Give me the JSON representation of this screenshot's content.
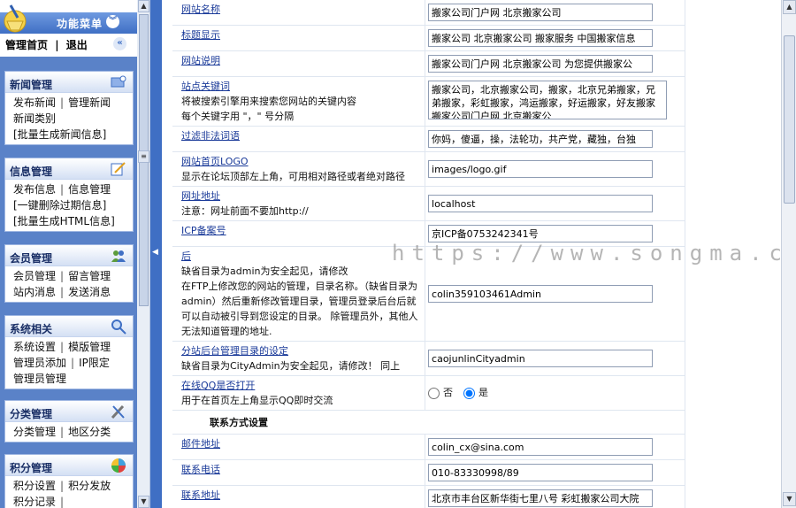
{
  "sidebar": {
    "title": "功能菜单",
    "home": "管理首页",
    "logout": "退出",
    "groups": [
      {
        "title": "新闻管理",
        "icon": "news-icon",
        "rows": [
          [
            "发布新闻",
            "管理新闻"
          ],
          [
            "新闻类别"
          ],
          [
            "[批量生成新闻信息]"
          ]
        ]
      },
      {
        "title": "信息管理",
        "icon": "edit-icon",
        "rows": [
          [
            "发布信息",
            "信息管理"
          ],
          [
            "[一键删除过期信息]"
          ],
          [
            "[批量生成HTML信息]"
          ]
        ]
      },
      {
        "title": "会员管理",
        "icon": "users-icon",
        "rows": [
          [
            "会员管理",
            "留言管理"
          ],
          [
            "站内消息",
            "发送消息"
          ]
        ]
      },
      {
        "title": "系统相关",
        "icon": "search-icon",
        "rows": [
          [
            "系统设置",
            "模版管理"
          ],
          [
            "管理员添加",
            "IP限定"
          ],
          [
            "管理员管理"
          ]
        ]
      },
      {
        "title": "分类管理",
        "icon": "tools-icon",
        "rows": [
          [
            "分类管理",
            "地区分类"
          ]
        ]
      },
      {
        "title": "积分管理",
        "icon": "color-wheel-icon",
        "rows": [
          [
            "积分设置",
            "积分发放"
          ],
          [
            "积分记录",
            ""
          ]
        ]
      }
    ]
  },
  "form": {
    "rows": [
      {
        "id": "site-name",
        "title": "网站名称",
        "desc": "",
        "value": "搬家公司门户网 北京搬家公司",
        "kind": "text"
      },
      {
        "id": "title-display",
        "title": "标题显示",
        "desc": "",
        "value": "搬家公司 北京搬家公司 搬家服务 中国搬家信息",
        "kind": "text"
      },
      {
        "id": "site-description",
        "title": "网站说明",
        "desc": "",
        "value": "搬家公司门户网 北京搬家公司 为您提供搬家公",
        "kind": "text"
      },
      {
        "id": "site-keywords",
        "title": "站点关键词",
        "desc": "将被搜索引擎用来搜索您网站的关键内容\n每个关键字用 \"，\" 号分隔",
        "value": "搬家公司，北京搬家公司，搬家，北京兄弟搬家，兄弟搬家，彩虹搬家，鸿运搬家，好运搬家，好友搬家 搬家公司门户网 北京搬家公",
        "kind": "textarea"
      },
      {
        "id": "filter-words",
        "title": "过滤非法词语",
        "desc": "",
        "value": "你妈，傻逼，操，法轮功，共产党，藏独，台独",
        "kind": "text"
      },
      {
        "id": "home-logo",
        "title": "网站首页LOGO",
        "desc": "显示在论坛顶部左上角，可用相对路径或者绝对路径",
        "value": "images/logo.gif",
        "kind": "text"
      },
      {
        "id": "site-url",
        "title": "网址地址",
        "desc": "注意：网址前面不要加http://",
        "value": "localhost",
        "kind": "text"
      },
      {
        "id": "icp",
        "title": "ICP备案号",
        "desc": "",
        "value": "京ICP备0753242341号",
        "kind": "text"
      },
      {
        "id": "admin-dir",
        "title": "后",
        "desc": "缺省目录为admin为安全起见，请修改\n在FTP上修改您的网站的管理，目录名称。（缺省目录为admin）然后重新修改管理目录，管理员登录后台后就可以自动被引导到您设定的目录。 除管理员外，其他人无法知道管理的地址.",
        "value": "colin359103461Admin",
        "kind": "text"
      },
      {
        "id": "branch-admin-dir",
        "title": "分站后台管理目录的设定",
        "desc": "缺省目录为CityAdmin为安全起见，请修改！ 同上",
        "value": "caojunlinCityadmin",
        "kind": "text"
      },
      {
        "id": "online-qq",
        "title": "在线QQ是否打开",
        "desc": "用于在首页左上角显示QQ即时交流",
        "kind": "radio",
        "options": [
          "否",
          "是"
        ],
        "selected": "是"
      },
      {
        "id": "contact-section",
        "kind": "section",
        "title": "联系方式设置"
      },
      {
        "id": "email",
        "title": "邮件地址",
        "desc": "",
        "value": "colin_cx@sina.com",
        "kind": "text"
      },
      {
        "id": "phone",
        "title": "联系电话",
        "desc": "",
        "value": "010-83330998/89",
        "kind": "text"
      },
      {
        "id": "address",
        "title": "联系地址",
        "desc": "",
        "value": "北京市丰台区新华街七里八号 彩虹搬家公司大院",
        "kind": "text"
      }
    ]
  },
  "watermark": "https://www.songma.com",
  "colors": {
    "sidebar_bg": "#5a82c8",
    "link": "#1a3a99",
    "accent": "#3f6fc4"
  }
}
